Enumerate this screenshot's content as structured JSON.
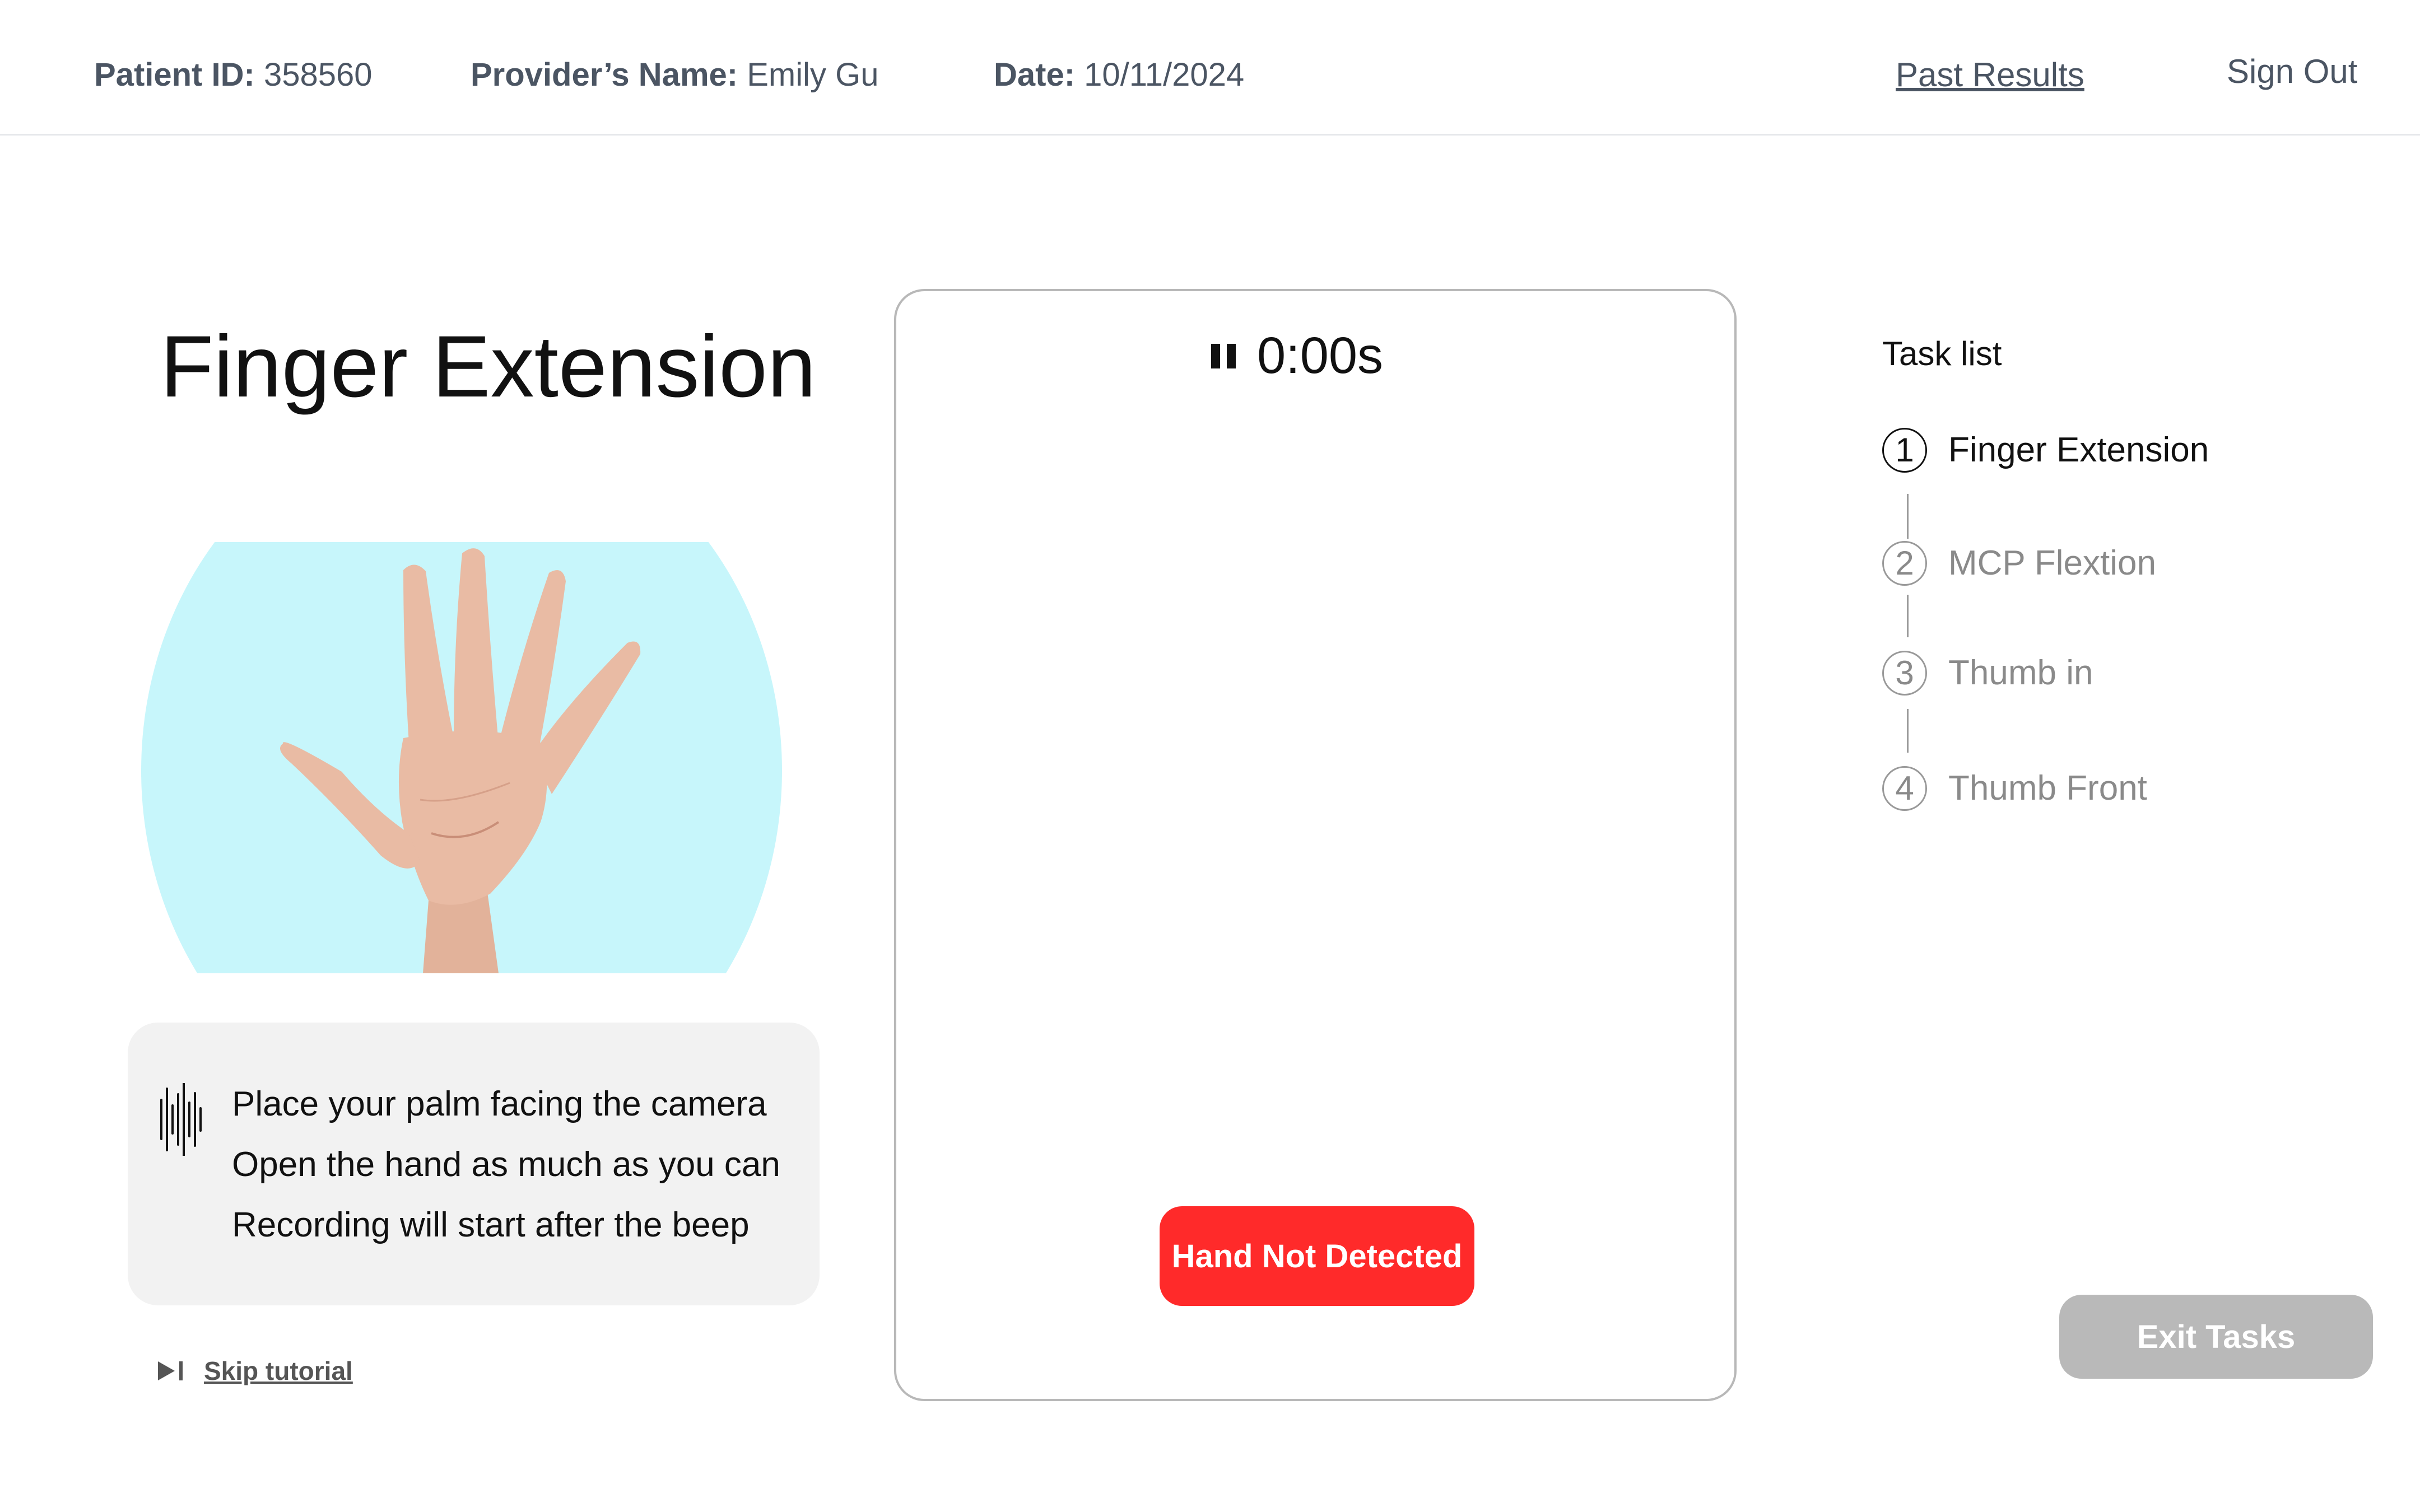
{
  "header": {
    "patient_id_label": "Patient ID:",
    "patient_id_value": "358560",
    "provider_label": "Provider’s Name:",
    "provider_value": "Emily Gu",
    "date_label": "Date:",
    "date_value": "10/11/2024",
    "past_results": "Past Results",
    "sign_out": "Sign Out"
  },
  "task": {
    "title": "Finger Extension",
    "instructions": [
      "Place your palm facing the camera",
      "Open the hand as much as you can",
      "Recording will start after the beep"
    ],
    "skip_label": "Skip tutorial",
    "icons": {
      "audio": "audio-waveform-icon",
      "skip": "skip-forward-icon"
    }
  },
  "camera": {
    "timer": "0:00s",
    "timer_icon": "pause-icon",
    "status": "Hand Not Detected"
  },
  "task_list": {
    "title": "Task list",
    "steps": [
      {
        "number": "1",
        "label": "Finger Extension",
        "active": true
      },
      {
        "number": "2",
        "label": "MCP Flextion",
        "active": false
      },
      {
        "number": "3",
        "label": "Thumb in",
        "active": false
      },
      {
        "number": "4",
        "label": "Thumb Front",
        "active": false
      }
    ]
  },
  "exit_button": "Exit Tasks",
  "colors": {
    "status_red": "#ff2a2a",
    "illustration_bg": "#c7f6fb",
    "exit_gray": "#b9b9b9",
    "card_gray": "#f2f2f2",
    "header_text": "#4b5563"
  }
}
